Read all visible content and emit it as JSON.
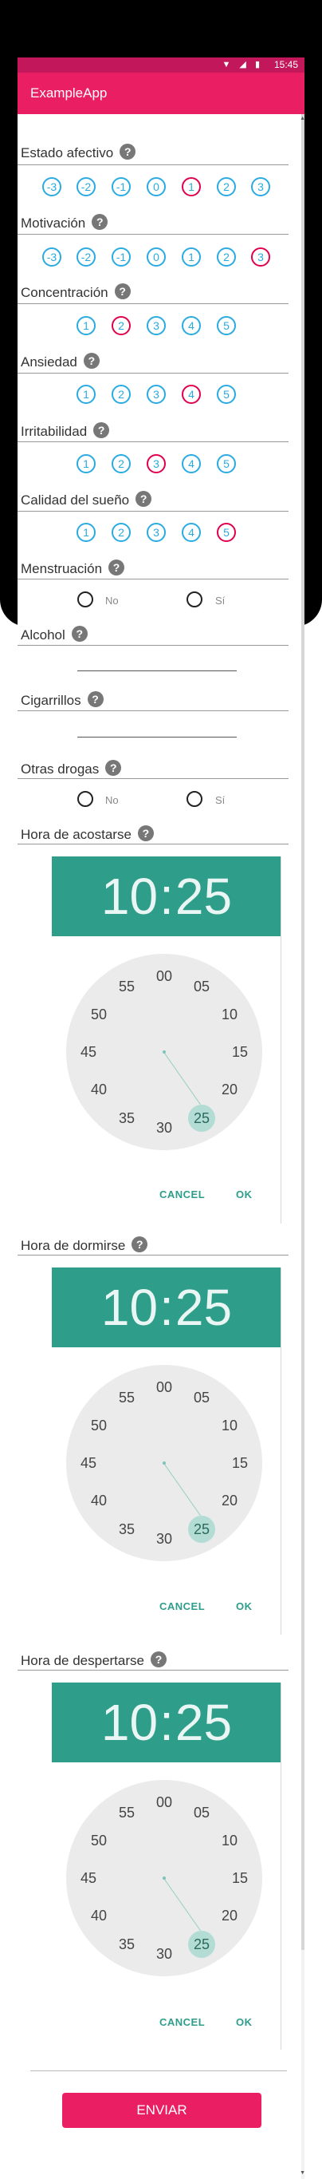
{
  "status_bar": {
    "time": "15:45",
    "icons": "▼ ◢ ▮"
  },
  "app": {
    "title": "ExampleApp"
  },
  "help_icon_glyph": "?",
  "scroll": {
    "up_arrow": "▲",
    "down_arrow": "▼"
  },
  "sections": {
    "estado_afectivo": {
      "label": "Estado afectivo",
      "options": [
        "-3",
        "-2",
        "-1",
        "0",
        "1",
        "2",
        "3"
      ],
      "selected": "1"
    },
    "motivacion": {
      "label": "Motivación",
      "options": [
        "-3",
        "-2",
        "-1",
        "0",
        "1",
        "2",
        "3"
      ],
      "selected": "3"
    },
    "concentracion": {
      "label": "Concentración",
      "options": [
        "1",
        "2",
        "3",
        "4",
        "5"
      ],
      "selected": "2"
    },
    "ansiedad": {
      "label": "Ansiedad",
      "options": [
        "1",
        "2",
        "3",
        "4",
        "5"
      ],
      "selected": "4"
    },
    "irritabilidad": {
      "label": "Irritabilidad",
      "options": [
        "1",
        "2",
        "3",
        "4",
        "5"
      ],
      "selected": "3"
    },
    "calidad_sueno": {
      "label": "Calidad del sueño",
      "options": [
        "1",
        "2",
        "3",
        "4",
        "5"
      ],
      "selected": "5"
    },
    "menstruacion": {
      "label": "Menstruación",
      "options": [
        "No",
        "Sí"
      ]
    },
    "alcohol": {
      "label": "Alcohol",
      "value": ""
    },
    "cigarrillos": {
      "label": "Cigarrillos",
      "value": ""
    },
    "otras_drogas": {
      "label": "Otras drogas",
      "options": [
        "No",
        "Sí"
      ]
    }
  },
  "time_pickers": [
    {
      "label": "Hora de acostarse",
      "hour": "10",
      "minute": "25",
      "cancel": "CANCEL",
      "ok": "OK"
    },
    {
      "label": "Hora de dormirse",
      "hour": "10",
      "minute": "25",
      "cancel": "CANCEL",
      "ok": "OK"
    },
    {
      "label": "Hora de despertarse",
      "hour": "10",
      "minute": "25",
      "cancel": "CANCEL",
      "ok": "OK"
    }
  ],
  "dial_minutes": [
    "00",
    "05",
    "10",
    "15",
    "20",
    "25",
    "30",
    "35",
    "40",
    "45",
    "50",
    "55"
  ],
  "colon": ":",
  "submit": {
    "label": "ENVIAR"
  },
  "colors": {
    "accent": "#e91e63",
    "status_bar": "#c2185b",
    "teal": "#2e9e8a",
    "option_border": "#29abe2",
    "option_selected": "#e0004d"
  }
}
